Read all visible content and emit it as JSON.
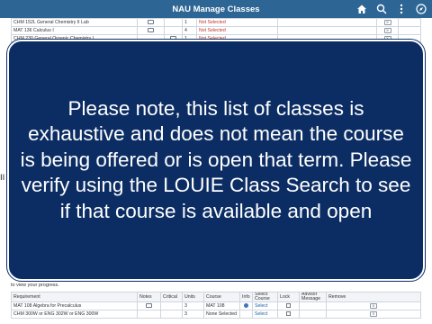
{
  "header": {
    "title": "NAU Manage Classes",
    "icons": [
      "home-icon",
      "search-icon",
      "more-icon",
      "compass-icon"
    ]
  },
  "top_rows": [
    {
      "course": "CHM 152L General Chemistry II Lab",
      "units": "1",
      "status": "Not Selected",
      "remove": "X"
    },
    {
      "course": "MAT 136 Calculus I",
      "units": "4",
      "status": "Not Selected",
      "remove": "X"
    },
    {
      "course": "CHM 230 General Organic Chemistry I",
      "units": "1",
      "status": "Not Selected",
      "remove": "X"
    }
  ],
  "notice": {
    "text": "Please note, this list of classes is exhaustive and does not mean the course is being offered or is open that term. Please verify using the LOUIE Class Search to see if that course is available and open"
  },
  "progress_text": "to view your progress.",
  "side_handle": "II",
  "bottom_table": {
    "headers": [
      "Requirement",
      "Notes",
      "Critical",
      "Units",
      "Course",
      "Info",
      "Select Course",
      "Lock",
      "Advisor Message",
      "Remove"
    ],
    "rows": [
      {
        "requirement": "MAT 108 Algebra for Precalculus",
        "units": "3",
        "course": "MAT 108",
        "select": "Select",
        "remove": "X"
      },
      {
        "requirement": "CHM 300W or ENG 302W or ENG 300W",
        "units": "3",
        "course": "None Selected",
        "select": "Select",
        "remove": "X"
      }
    ]
  },
  "colors": {
    "header": "#2d6694",
    "notice_bg": "#0c2d63",
    "status_red": "#c0312e"
  }
}
